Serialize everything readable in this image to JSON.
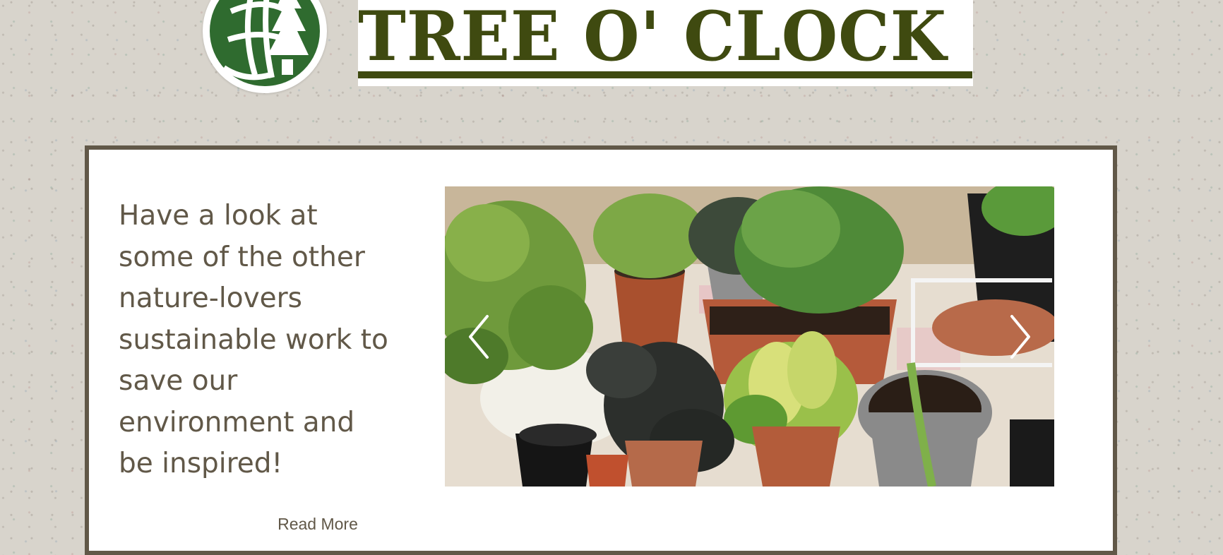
{
  "header": {
    "brand_title": "TREE O' CLOCK",
    "brand_color": "#3f4a10",
    "logo_icon": "tree-globe-logo",
    "logo_color": "#2f6b2f"
  },
  "main": {
    "headline": "Have a look at\nsome of the other\nnature-lovers\nsustainable work to\nsave our\nenvironment  and\nbe inspired!",
    "read_more_label": "Read More",
    "text_color": "#615848",
    "frame_color": "#615848"
  },
  "gallery": {
    "image": "potted-plants-photo",
    "prev_icon": "chevron-left-icon",
    "next_icon": "chevron-right-icon"
  }
}
